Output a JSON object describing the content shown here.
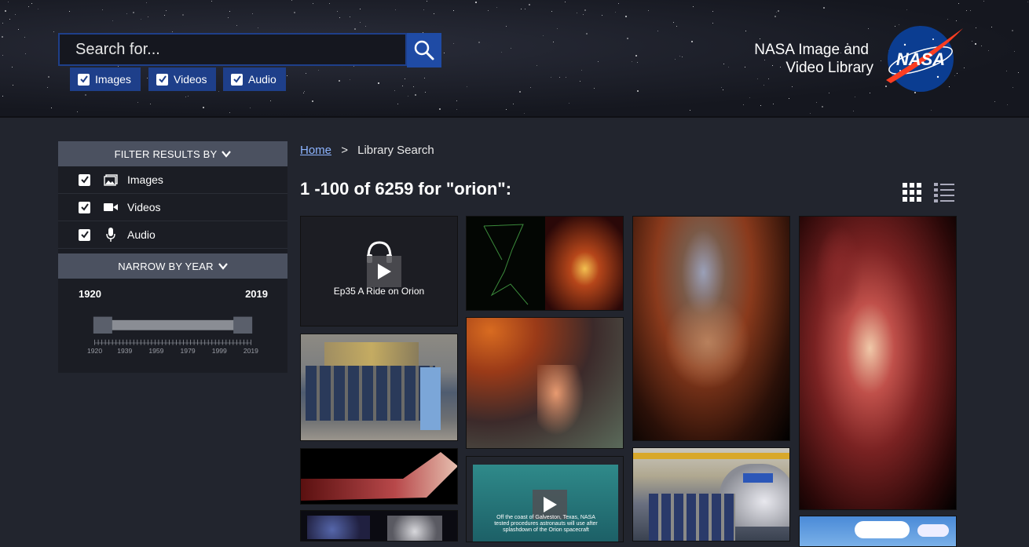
{
  "header": {
    "search": {
      "placeholder": "Search for..."
    },
    "media_types": [
      {
        "label": "Images",
        "checked": true
      },
      {
        "label": "Videos",
        "checked": true
      },
      {
        "label": "Audio",
        "checked": true
      }
    ],
    "brand_line1": "NASA Image and",
    "brand_line2": "Video Library",
    "logo_text": "NASA"
  },
  "sidebar": {
    "filter_heading": "FILTER RESULTS BY",
    "filters": [
      {
        "label": "Images",
        "icon": "image-icon",
        "checked": true
      },
      {
        "label": "Videos",
        "icon": "video-camera-icon",
        "checked": true
      },
      {
        "label": "Audio",
        "icon": "microphone-icon",
        "checked": true
      }
    ],
    "year_heading": "NARROW BY YEAR",
    "year_start": "1920",
    "year_end": "2019",
    "ticks": [
      "1920",
      "1939",
      "1959",
      "1979",
      "1999",
      "2019"
    ]
  },
  "breadcrumb": {
    "home": "Home",
    "separator": ">",
    "current": "Library Search"
  },
  "results": {
    "title": "1 -100 of 6259 for \"orion\":",
    "tiles": [
      {
        "caption": "Ep35 A Ride on Orion",
        "kind": "audio"
      },
      {
        "caption": "Off the coast of Galveston, Texas, NASA tested procedures astronauts will use after splashdown of the Orion spacecraft",
        "kind": "video"
      }
    ]
  },
  "colors": {
    "accent": "#1f4ba5",
    "panel_head": "#4b5160",
    "link": "#8db4ff"
  }
}
